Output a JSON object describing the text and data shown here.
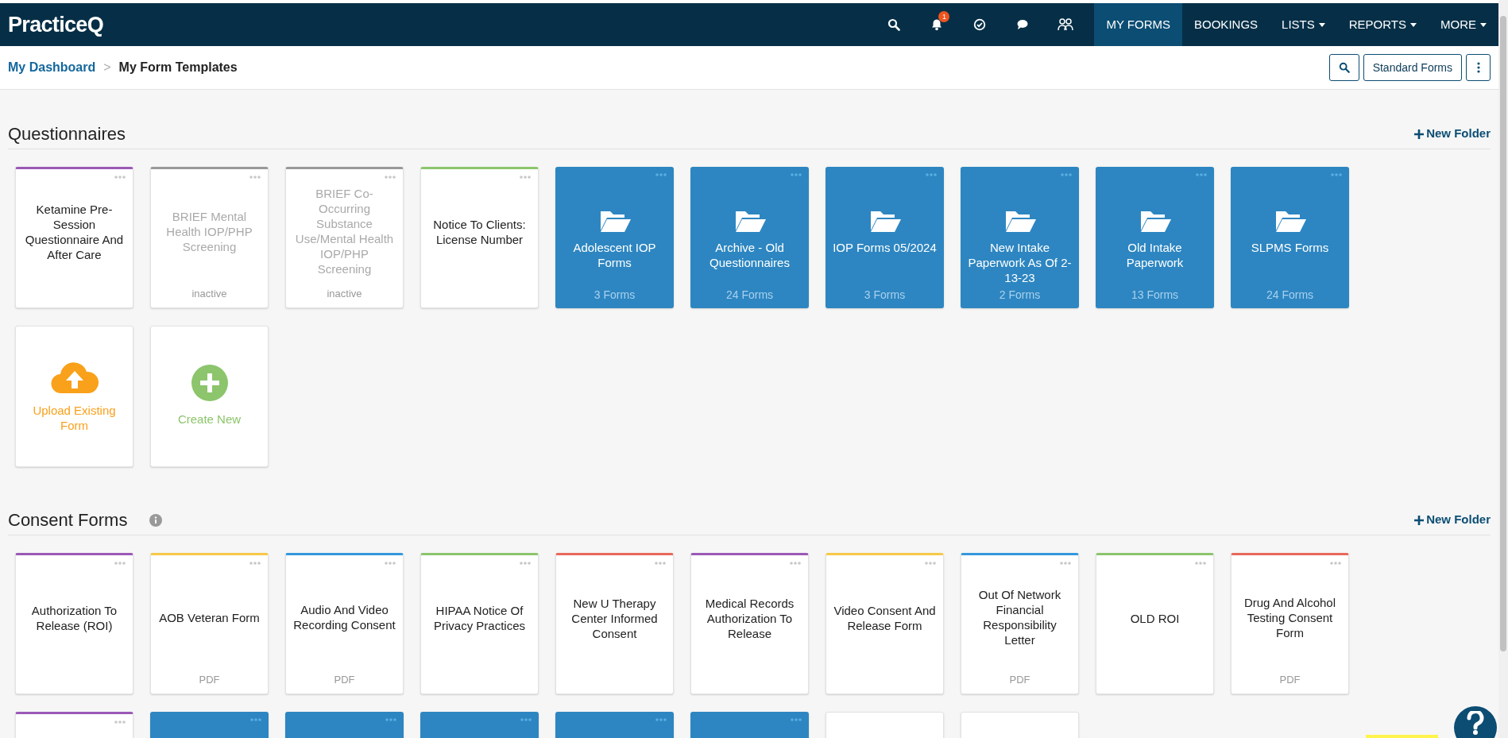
{
  "nav": {
    "logo": "PracticeQ",
    "icons": [
      {
        "kind": "search"
      },
      {
        "kind": "bell",
        "badge": "1"
      },
      {
        "kind": "check"
      },
      {
        "kind": "chat"
      },
      {
        "kind": "people"
      }
    ],
    "tabs": [
      {
        "label": "MY FORMS",
        "selected": true,
        "dropdown": false
      },
      {
        "label": "BOOKINGS",
        "selected": false,
        "dropdown": false
      },
      {
        "label": "LISTS",
        "selected": false,
        "dropdown": true
      },
      {
        "label": "REPORTS",
        "selected": false,
        "dropdown": true
      },
      {
        "label": "MORE",
        "selected": false,
        "dropdown": true
      }
    ]
  },
  "breadcrumb": {
    "items": [
      "My Dashboard",
      "My Form Templates"
    ],
    "separator": ">"
  },
  "toolbar": [
    {
      "kind": "search"
    },
    {
      "kind": "text",
      "label": "Standard Forms"
    },
    {
      "kind": "kebab"
    }
  ],
  "sections": [
    {
      "title": "Questionnaires",
      "info": false,
      "new_folder": "New Folder",
      "items": [
        {
          "kind": "form",
          "title": "Ketamine Pre-Session Questionnaire And After Care",
          "color": "#9b59b6",
          "disabled": false
        },
        {
          "kind": "form",
          "title": "BRIEF Mental Health IOP/PHP Screening",
          "color": "#999999",
          "disabled": true,
          "footer": "inactive"
        },
        {
          "kind": "form",
          "title": "BRIEF Co-Occurring Substance Use/Mental Health IOP/PHP Screening",
          "color": "#999999",
          "disabled": true,
          "footer": "inactive"
        },
        {
          "kind": "form",
          "title": "Notice To Clients: License Number",
          "color": "#8cc56c",
          "disabled": false
        },
        {
          "kind": "folder",
          "title": "Adolescent IOP Forms",
          "count": "3 Forms"
        },
        {
          "kind": "folder",
          "title": "Archive - Old Questionnaires",
          "count": "24 Forms"
        },
        {
          "kind": "folder",
          "title": "IOP Forms 05/2024",
          "count": "3 Forms"
        },
        {
          "kind": "folder",
          "title": "New Intake Paperwork As Of 2-13-23",
          "count": "2 Forms"
        },
        {
          "kind": "folder",
          "title": "Old Intake Paperwork",
          "count": "13 Forms"
        },
        {
          "kind": "folder",
          "title": "SLPMS Forms",
          "count": "24 Forms"
        },
        {
          "kind": "upload",
          "title": "Upload Existing Form"
        },
        {
          "kind": "create",
          "title": "Create New"
        }
      ]
    },
    {
      "title": "Consent Forms",
      "info": true,
      "new_folder": "New Folder",
      "items": [
        {
          "kind": "form",
          "title": "Authorization To Release (ROI)",
          "color": "#9b59b6",
          "disabled": false
        },
        {
          "kind": "form",
          "title": "AOB Veteran Form",
          "color": "#f7c948",
          "disabled": false,
          "footer": "PDF"
        },
        {
          "kind": "form",
          "title": "Audio And Video Recording Consent",
          "color": "#3498db",
          "disabled": false,
          "footer": "PDF"
        },
        {
          "kind": "form",
          "title": "HIPAA Notice Of Privacy Practices",
          "color": "#8cc56c",
          "disabled": false
        },
        {
          "kind": "form",
          "title": "New U Therapy Center Informed Consent",
          "color": "#e8685a",
          "disabled": false
        },
        {
          "kind": "form",
          "title": "Medical Records Authorization To Release",
          "color": "#9b59b6",
          "disabled": false
        },
        {
          "kind": "form",
          "title": "Video Consent And Release Form",
          "color": "#f7c948",
          "disabled": false
        },
        {
          "kind": "form",
          "title": "Out Of Network Financial Responsibility Letter",
          "color": "#3498db",
          "disabled": false,
          "footer": "PDF"
        },
        {
          "kind": "form",
          "title": "OLD ROI",
          "color": "#8cc56c",
          "disabled": false
        },
        {
          "kind": "form",
          "title": "Drug And Alcohol Testing Consent Form",
          "color": "#e8685a",
          "disabled": false,
          "footer": "PDF"
        },
        {
          "kind": "form",
          "color": "#9b59b6"
        },
        {
          "kind": "folder"
        },
        {
          "kind": "folder"
        },
        {
          "kind": "folder"
        },
        {
          "kind": "folder"
        },
        {
          "kind": "folder"
        },
        {
          "kind": "blank"
        },
        {
          "kind": "blank"
        }
      ]
    }
  ]
}
